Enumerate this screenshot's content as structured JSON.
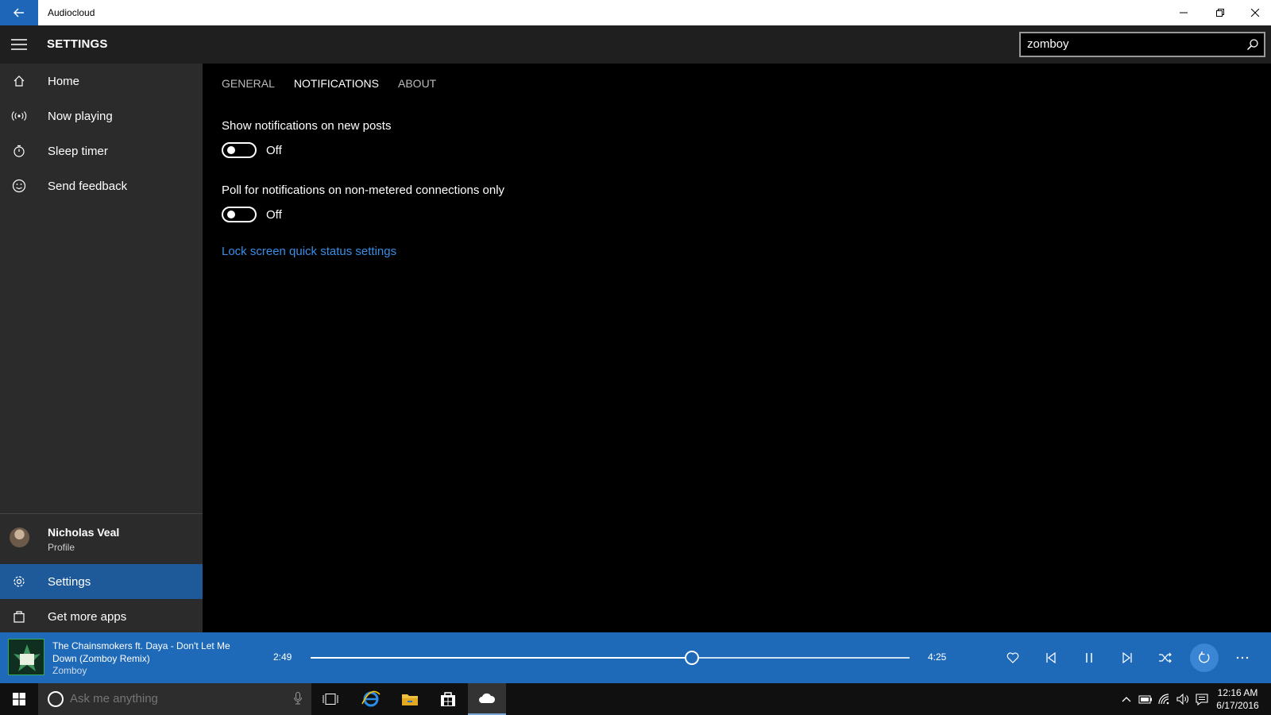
{
  "window": {
    "title": "Audiocloud"
  },
  "header": {
    "title": "SETTINGS",
    "search_value": "zomboy"
  },
  "sidebar": {
    "items": [
      {
        "label": "Home"
      },
      {
        "label": "Now playing"
      },
      {
        "label": "Sleep timer"
      },
      {
        "label": "Send feedback"
      }
    ],
    "profile": {
      "name": "Nicholas Veal",
      "subtitle": "Profile"
    },
    "bottom_items": [
      {
        "label": "Settings",
        "selected": true
      },
      {
        "label": "Get more apps"
      }
    ]
  },
  "main": {
    "tabs": [
      {
        "label": "GENERAL"
      },
      {
        "label": "NOTIFICATIONS",
        "active": true
      },
      {
        "label": "ABOUT"
      }
    ],
    "settings": [
      {
        "label": "Show notifications on new posts",
        "state": "Off"
      },
      {
        "label": "Poll for notifications on non-metered connections only",
        "state": "Off"
      }
    ],
    "link": "Lock screen quick status settings"
  },
  "player": {
    "track_title": "The Chainsmokers ft. Daya - Don't Let Me Down (Zomboy Remix)",
    "artist": "Zomboy",
    "current_time": "2:49",
    "total_time": "4:25",
    "progress": 0.637
  },
  "taskbar": {
    "search_placeholder": "Ask me anything",
    "time": "12:16 AM",
    "date": "6/17/2016"
  },
  "colors": {
    "accent": "#1e6ab8",
    "titlebar_back": "#1e67b8",
    "sidebar_bg": "#2b2b2b",
    "selected_nav": "#1e5a9a",
    "link": "#3a8ee6"
  }
}
